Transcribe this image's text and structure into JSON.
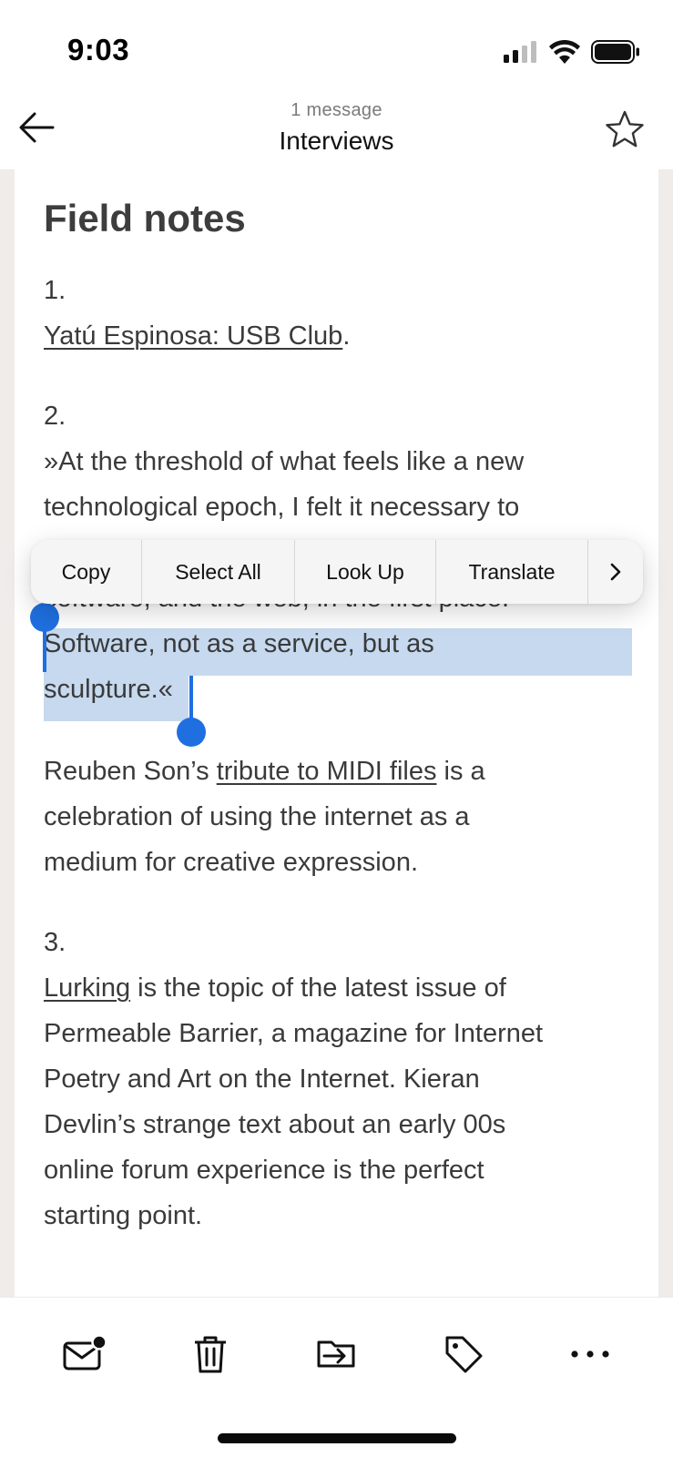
{
  "status_bar": {
    "time": "9:03"
  },
  "header": {
    "subtitle": "1 message",
    "title": "Interviews"
  },
  "article": {
    "title": "Field notes",
    "item1": {
      "number": "1.",
      "link": "Yatú Espinosa: USB Club",
      "after_link": "."
    },
    "item2": {
      "number": "2.",
      "quote_lines": [
        "»At the threshold of what feels like a new",
        "technological epoch, I felt it necessary to",
        "software, and the web, in the first place.",
        "Software, not as a service, but as",
        "sculpture.«"
      ],
      "para_line1_before": "Reuben Son’s ",
      "para_line1_link": "tribute to MIDI files",
      "para_line1_after": " is a",
      "para_lines": [
        "celebration of using the internet as a",
        "medium for creative expression."
      ]
    },
    "item3": {
      "number": "3.",
      "line1_link": "Lurking",
      "line1_after": " is the topic of the latest issue of",
      "lines": [
        "Permeable Barrier, a magazine for Internet",
        "Poetry and Art on the Internet. Kieran",
        "Devlin’s strange text about an early 00s",
        "online forum experience is the perfect",
        "starting point."
      ]
    }
  },
  "context_menu": {
    "items": [
      "Copy",
      "Select All",
      "Look Up",
      "Translate"
    ],
    "more_icon": "chevron-right-icon"
  },
  "toolbar": {
    "icons": [
      "mail-unread-icon",
      "trash-icon",
      "move-to-folder-icon",
      "tag-icon",
      "more-icon"
    ]
  },
  "colors": {
    "selection": "#c6d9ee",
    "handle": "#1f6fe0",
    "page_margin": "#efecea"
  }
}
